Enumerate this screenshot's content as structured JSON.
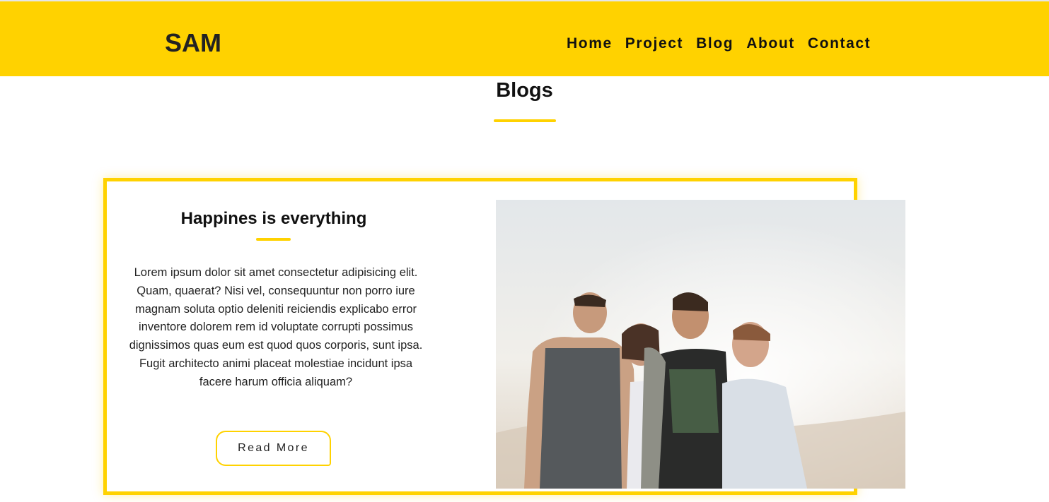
{
  "header": {
    "brand": "SAM",
    "nav": [
      "Home",
      "Project",
      "Blog",
      "About",
      "Contact"
    ]
  },
  "main": {
    "section_title": "Blogs",
    "post": {
      "title": "Happines is everything",
      "body": "Lorem ipsum dolor sit amet consectetur adipisicing elit. Quam, quaerat? Nisi vel, consequuntur non porro iure magnam soluta optio deleniti reiciendis explicabo error inventore dolorem rem id voluptate corrupti possimus dignissimos quas eum est quod quos corporis, sunt ipsa. Fugit architecto animi placeat molestiae incidunt ipsa facere harum officia aliquam?",
      "button": "Read More",
      "image": "group-of-friends-laughing-photo"
    }
  },
  "colors": {
    "accent": "#ffd200",
    "text": "#111111",
    "background": "#ffffff"
  }
}
